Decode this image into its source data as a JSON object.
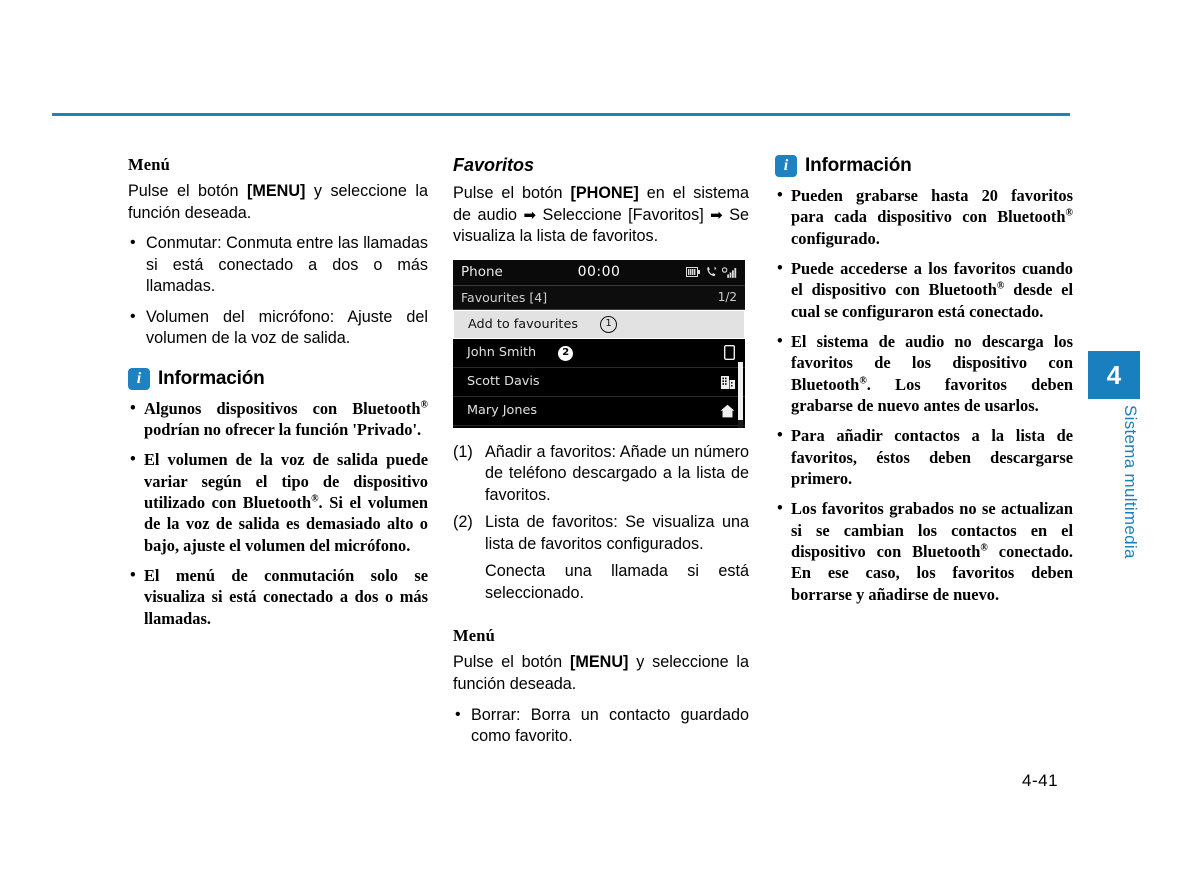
{
  "page": {
    "number": "4-41",
    "rule_color": "#1f82c0"
  },
  "chapter_tab": {
    "number": "4",
    "label": "Sistema multimedia",
    "color": "#1a7fbf"
  },
  "column1": {
    "menu_heading": "Menú",
    "menu_intro_pre": "Pulse el botón ",
    "menu_intro_key": "[MENU]",
    "menu_intro_post": " y seleccione la función deseada.",
    "bullets": [
      "Conmutar: Conmuta entre las llamadas si está conectado a dos o más llamadas.",
      "Volumen del micrófono: Ajuste del volumen de la voz de salida."
    ],
    "info": {
      "badge": "i",
      "title": "Información",
      "items": [
        "Algunos dispositivos con Bluetooth® podrían no ofrecer la función 'Privado'.",
        "El volumen de la voz de salida puede variar según el tipo de dispositivo utilizado con Bluetooth®. Si el volumen de la voz de salida es demasiado alto o bajo, ajuste el volumen del micrófono.",
        "El menú de conmutación solo se visualiza si está conectado a dos o más llamadas."
      ]
    }
  },
  "column2": {
    "heading": "Favoritos",
    "intro_pre": "Pulse el botón ",
    "intro_key": "[PHONE]",
    "intro_mid": " en el sistema de audio ",
    "intro_arrow1": "➡",
    "intro_mid2": " Seleccione [Favoritos] ",
    "intro_arrow2": "➡",
    "intro_post": " Se visualiza la lista de favoritos.",
    "screen": {
      "status_title": "Phone",
      "clock": "00:00",
      "status_icons": [
        "battery-icon",
        "bluetooth-phone-icon",
        "signal-strength-icon"
      ],
      "subheader_label": "Favourites [4]",
      "page_indicator": "1/2",
      "rows": [
        {
          "name": "Add to favourites",
          "badge": "1",
          "badge_style": "outline",
          "icon": "",
          "selected": true
        },
        {
          "name": "John Smith",
          "badge": "2",
          "badge_style": "filled",
          "icon": "mobile-phone-icon",
          "selected": false
        },
        {
          "name": "Scott Davis",
          "badge": "",
          "badge_style": "",
          "icon": "office-building-icon",
          "selected": false
        },
        {
          "name": "Mary Jones",
          "badge": "",
          "badge_style": "",
          "icon": "home-icon",
          "selected": false
        }
      ]
    },
    "numbered": [
      {
        "marker": "(1)",
        "text": "Añadir a favoritos: Añade un número de teléfono descargado a la lista de favoritos."
      },
      {
        "marker": "(2)",
        "text": "Lista de favoritos: Se visualiza una lista de favoritos configurados."
      }
    ],
    "numbered_extra": "Conecta una llamada si está seleccionado.",
    "menu_heading": "Menú",
    "menu_intro_pre": "Pulse el botón ",
    "menu_intro_key": "[MENU]",
    "menu_intro_post": " y seleccione la función deseada.",
    "menu_bullets": [
      "Borrar: Borra un contacto guardado como favorito."
    ]
  },
  "column3": {
    "info": {
      "badge": "i",
      "title": "Información",
      "items": [
        "Pueden grabarse hasta 20 favoritos para cada dispositivo con Bluetooth® configurado.",
        "Puede accederse a los favoritos cuando el dispositivo con Bluetooth® desde el cual se configuraron está conectado.",
        "El sistema de audio no descarga los favoritos de los dispositivo con Bluetooth®. Los favoritos deben grabarse de nuevo antes de usarlos.",
        "Para añadir contactos a la lista de favoritos, éstos deben descargarse primero.",
        "Los favoritos grabados no se actualizan si se cambian los contactos en el dispositivo con Bluetooth® conectado. En ese caso, los favoritos deben borrarse y añadirse de nuevo."
      ]
    }
  }
}
